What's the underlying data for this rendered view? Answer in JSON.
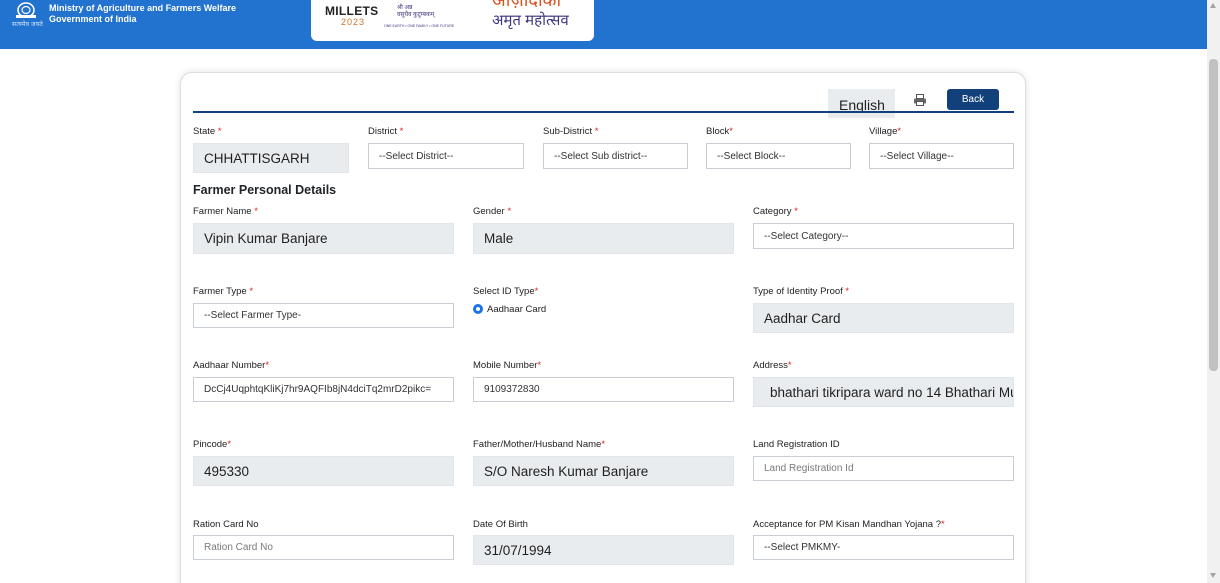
{
  "header": {
    "emblem_caption": "सत्यमेव जयते",
    "ministry_line1": "Ministry of Agriculture and Farmers Welfare",
    "ministry_line2": "Government of India"
  },
  "banner": {
    "millets": "MILLETS",
    "year": "2023",
    "hindi_small": "श्री अन्न",
    "hindi_small_2": "वसुधैव कुटुम्बकम्",
    "tagline": "ONE EARTH • ONE FAMILY • ONE FUTURE",
    "azadi_top": "आज़ादीका",
    "azadi_bottom": "अमृत महोत्सव"
  },
  "toolbar": {
    "language": "English",
    "back": "Back"
  },
  "location": {
    "state": {
      "label": "State",
      "value": "CHHATTISGARH"
    },
    "district": {
      "label": "District",
      "value": "--Select District--"
    },
    "sub_district": {
      "label": "Sub-District",
      "value": "--Select Sub district--"
    },
    "block": {
      "label": "Block",
      "value": "--Select Block--"
    },
    "village": {
      "label": "Village",
      "value": "--Select Village--"
    }
  },
  "section_title": "Farmer Personal Details",
  "form": {
    "farmer_name": {
      "label": "Farmer Name",
      "value": "Vipin Kumar Banjare"
    },
    "gender": {
      "label": "Gender",
      "value": "Male"
    },
    "category": {
      "label": "Category",
      "value": "--Select Category--"
    },
    "farmer_type": {
      "label": "Farmer Type",
      "value": "--Select Farmer Type-"
    },
    "id_type": {
      "label": "Select ID Type",
      "option": "Aadhaar Card"
    },
    "identity_proof": {
      "label": "Type of Identity Proof",
      "value": "Aadhar Card"
    },
    "aadhaar": {
      "label": "Aadhaar Number",
      "value": "DcCj4UqphtqKliKj7hr9AQFIb8jN4dciTq2mrD2pikc="
    },
    "mobile": {
      "label": "Mobile Number",
      "value": "9109372830"
    },
    "address": {
      "label": "Address",
      "value": "bhathari tikripara ward no 14 Bhathari Mu"
    },
    "pincode": {
      "label": "Pincode",
      "value": "495330"
    },
    "relative": {
      "label": "Father/Mother/Husband Name",
      "value": "S/O Naresh Kumar Banjare"
    },
    "land_id": {
      "label": "Land Registration ID",
      "placeholder": "Land Registration Id"
    },
    "ration": {
      "label": "Ration Card No",
      "placeholder": "Ration Card No"
    },
    "dob": {
      "label": "Date Of Birth",
      "value": "31/07/1994"
    },
    "pmkmy": {
      "label": "Acceptance for PM Kisan Mandhan Yojana ?",
      "value": "--Select PMKMY-"
    }
  },
  "colors": {
    "header": "#2272d0",
    "back_button": "#12407a",
    "required": "#d9231d",
    "readonly": "#e9ecef"
  }
}
